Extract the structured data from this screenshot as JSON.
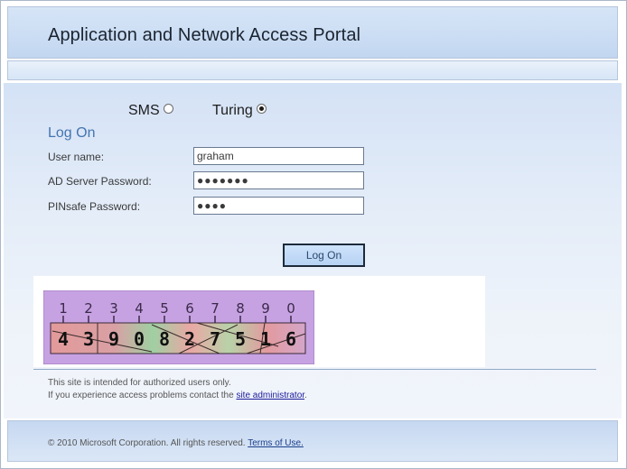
{
  "header": {
    "title": "Application and Network Access Portal"
  },
  "auth_mode": {
    "options": [
      {
        "label": "SMS",
        "selected": false
      },
      {
        "label": "Turing",
        "selected": true
      }
    ]
  },
  "form": {
    "heading": "Log On",
    "username_label": "User name:",
    "username_value": "graham",
    "ad_password_label": "AD Server Password:",
    "ad_password_value": "●●●●●●●",
    "pinsafe_label": "PINsafe Password:",
    "pinsafe_value": "●●●●",
    "submit_label": "Log On"
  },
  "turing_image": {
    "positions": [
      "1",
      "2",
      "3",
      "4",
      "5",
      "6",
      "7",
      "8",
      "9",
      "0"
    ],
    "digits": [
      "4",
      "3",
      "9",
      "0",
      "8",
      "2",
      "7",
      "5",
      "1",
      "6"
    ]
  },
  "notice": {
    "line1": "This site is intended for authorized users only.",
    "line2_prefix": "If you experience access problems contact the ",
    "line2_link": "site administrator",
    "line2_suffix": "."
  },
  "footer": {
    "copyright": "© 2010 Microsoft Corporation. All rights reserved.",
    "terms_link": "Terms of Use."
  },
  "colors": {
    "header_bg": "#cfe0f5",
    "accent_heading": "#4474b0",
    "captcha_bg": "#c9a3e3",
    "link": "#1a1a9a"
  }
}
